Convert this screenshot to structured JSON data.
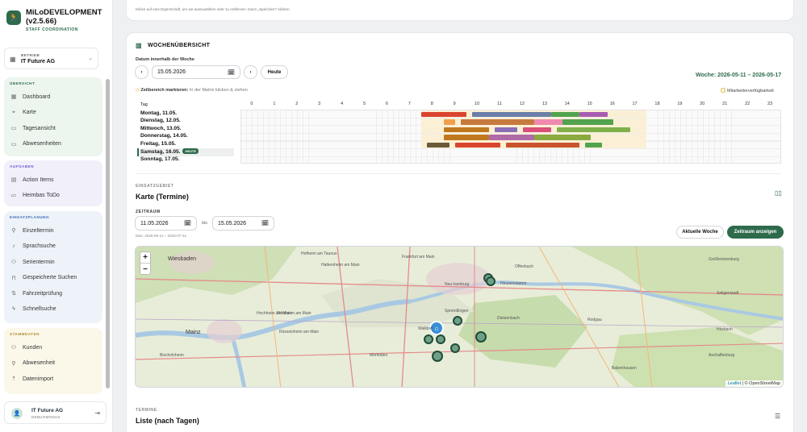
{
  "app": {
    "name": "MiLoDEVELOPMENT (v2.5.66)",
    "subtitle": "STAFF COORDINATION"
  },
  "betrieb": {
    "label": "BETRIEB",
    "value": "IT Future AG"
  },
  "sidebar": {
    "groups": [
      {
        "title": "ÜBERSICHT",
        "color": "#2e6b4c",
        "items": [
          {
            "label": "Dashboard",
            "icon": "dashboard-icon"
          },
          {
            "label": "Karte",
            "icon": "map-pin-icon"
          },
          {
            "label": "Tagesansicht",
            "icon": "calendar-icon"
          },
          {
            "label": "Abwesenheiten",
            "icon": "calendar-off-icon"
          }
        ]
      },
      {
        "title": "AUFGABEN",
        "color": "#6d5bd0",
        "items": [
          {
            "label": "Action Items",
            "icon": "clipboard-icon"
          },
          {
            "label": "Heimbas ToDo",
            "icon": "list-check-icon"
          }
        ]
      },
      {
        "title": "EINSATZPLANUNG",
        "color": "#3b6db3",
        "items": [
          {
            "label": "Einzeltermin",
            "icon": "person-walk-icon"
          },
          {
            "label": "Sprachsuche",
            "icon": "microphone-icon"
          },
          {
            "label": "Serientermin",
            "icon": "users-icon"
          },
          {
            "label": "Gespeicherte Suchen",
            "icon": "bookmark-icon"
          },
          {
            "label": "Fahrzeitprüfung",
            "icon": "route-icon"
          },
          {
            "label": "Schnellsuche",
            "icon": "lightning-icon"
          }
        ]
      },
      {
        "title": "STAMMDATEN",
        "color": "#b0892a",
        "items": [
          {
            "label": "Kunden",
            "icon": "users-icon"
          },
          {
            "label": "Abwesenheit",
            "icon": "person-off-icon"
          },
          {
            "label": "Datenimport",
            "icon": "upload-icon"
          }
        ]
      }
    ]
  },
  "user": {
    "name": "IT Future AG",
    "role": "DEBUGMODUS"
  },
  "top_hint": "Klicke auf eine Eigenschaft, um sie auszuwählen oder zu entfernen. Dann „Speichern“ klicken.",
  "woche": {
    "title": "WOCHENÜBERSICHT",
    "date_label": "Datum innerhalb der Woche",
    "date_value": "15.05.2026",
    "prev": "‹",
    "next": "›",
    "today_button": "Heute",
    "week_range": "Woche: 2026-05-11 – 2026-05-17",
    "zeit_label": "Zeitbereich markieren:",
    "zeit_hint": "In der Matrix klicken & ziehen",
    "avail_label": "Mitarbeiterverfügbarkeit",
    "col_header": "Tag",
    "today_badge": "HEUTE",
    "days": [
      "Montag, 11.05.",
      "Dienstag, 12.05.",
      "Mittwoch, 13.05.",
      "Donnerstag, 14.05.",
      "Freitag, 15.05.",
      "Samstag, 16.05.",
      "Sonntag, 17.05."
    ],
    "hours": [
      "0",
      "1",
      "2",
      "3",
      "4",
      "5",
      "6",
      "7",
      "8",
      "9",
      "10",
      "11",
      "12",
      "13",
      "14",
      "15",
      "16",
      "17",
      "18",
      "19",
      "20",
      "21",
      "22",
      "23"
    ]
  },
  "karte": {
    "eyebrow": "EINSATZGEBIET",
    "title": "Karte (Termine)",
    "zeitraum_label": "ZEITRAUM",
    "from": "11.05.2026",
    "bis": "bis",
    "to": "15.05.2026",
    "max": "Max: 2026-05-11 – 2026-07-31",
    "btn_current": "Aktuelle Woche",
    "btn_show": "Zeitraum anzeigen",
    "zoom_in": "+",
    "zoom_out": "−",
    "attribution_leaflet": "Leaflet",
    "attribution_osm": "| © OpenStreetMap",
    "place_labels": [
      "Wiesbaden",
      "Hofheim am Taunus",
      "Hattersheim am Main",
      "Frankfurt am Main",
      "Offenbach",
      "Neu-Isenburg",
      "Heusenstamm",
      "Großkrotzenburg",
      "Seligenstadt",
      "Hochheim am Main",
      "Flörsheim am Main",
      "Mainz",
      "Rüsselsheim am Main",
      "Sprendlingen",
      "Dietzenbach",
      "Rodgau",
      "Walldorf",
      "Mörfelden",
      "Babenhausen",
      "Aschaffenburg",
      "Bischofsheim",
      "Hösbach"
    ]
  },
  "termine": {
    "eyebrow": "TERMINE",
    "title": "Liste (nach Tagen)"
  },
  "colors": {
    "accent": "#2e6b4c"
  }
}
